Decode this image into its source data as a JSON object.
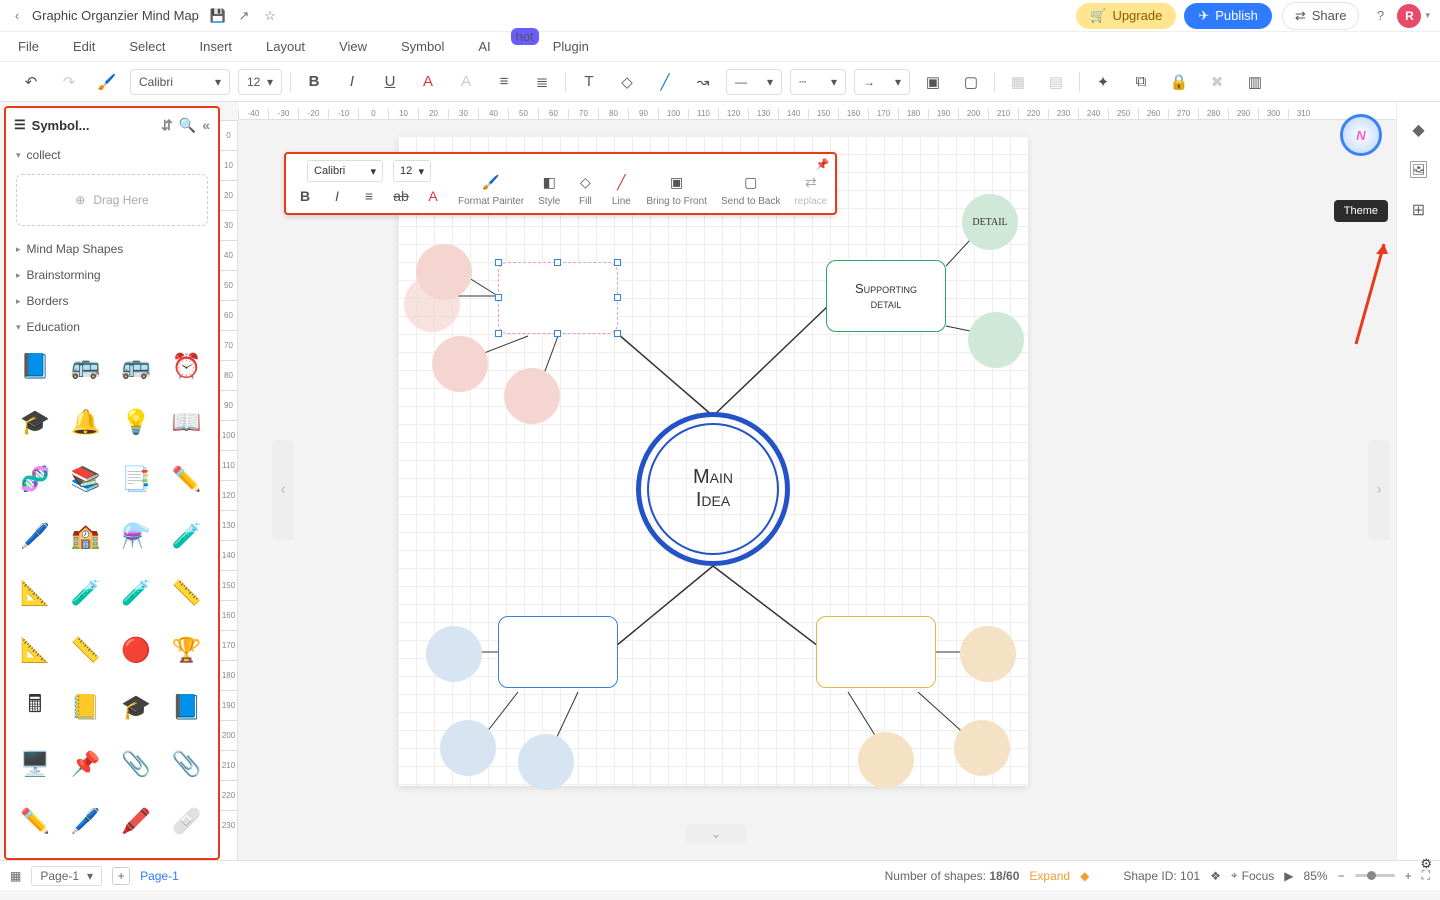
{
  "titlebar": {
    "doc_title": "Graphic Organzier Mind Map",
    "upgrade": "Upgrade",
    "publish": "Publish",
    "share": "Share",
    "avatar": "R"
  },
  "menubar": {
    "file": "File",
    "edit": "Edit",
    "select": "Select",
    "insert": "Insert",
    "layout": "Layout",
    "view": "View",
    "symbol": "Symbol",
    "ai": "AI",
    "ai_badge": "hot",
    "plugin": "Plugin"
  },
  "toolbar": {
    "font": "Calibri",
    "size": "12"
  },
  "left": {
    "title": "Symbol...",
    "sections": {
      "collect": "collect",
      "drag": "Drag Here",
      "mmshapes": "Mind Map Shapes",
      "brain": "Brainstorming",
      "borders": "Borders",
      "edu": "Education"
    },
    "icons": [
      "📘",
      "🚌",
      "🚌",
      "⏰",
      "🎓",
      "🔔",
      "💡",
      "📖",
      "🧬",
      "📚",
      "📑",
      "✏️",
      "🖊️",
      "🏫",
      "⚗️",
      "🧪",
      "📐",
      "🧪",
      "🧪",
      "📏",
      "📐",
      "📏",
      "🔴",
      "🏆",
      "🖩",
      "📒",
      "🎓",
      "📘",
      "🖥️",
      "📌",
      "📎",
      "📎",
      "✏️",
      "🖊️",
      "🖍️",
      "🩹"
    ]
  },
  "float": {
    "font": "Calibri",
    "size": "12",
    "fp": "Format Painter",
    "style": "Style",
    "fill": "Fill",
    "line": "Line",
    "btf": "Bring to Front",
    "stb": "Send to Back",
    "replace": "replace"
  },
  "mind": {
    "main1": "Main",
    "main2": "Idea",
    "sup1": "Supporting",
    "sup2": "detail",
    "detail": "DETAIL"
  },
  "right": {
    "tooltip": "Theme"
  },
  "ruler_h": [
    "-40",
    "-30",
    "-20",
    "-10",
    "0",
    "10",
    "20",
    "30",
    "40",
    "50",
    "60",
    "70",
    "80",
    "90",
    "100",
    "110",
    "120",
    "130",
    "140",
    "150",
    "160",
    "170",
    "180",
    "190",
    "200",
    "210",
    "220",
    "230",
    "240",
    "250",
    "260",
    "270",
    "280",
    "290",
    "300",
    "310"
  ],
  "ruler_v": [
    "0",
    "10",
    "20",
    "30",
    "40",
    "50",
    "60",
    "70",
    "80",
    "90",
    "100",
    "110",
    "120",
    "130",
    "140",
    "150",
    "160",
    "170",
    "180",
    "190",
    "200",
    "210",
    "220",
    "230"
  ],
  "status": {
    "page_sel": "Page-1",
    "tab": "Page-1",
    "shapes_lbl": "Number of shapes:",
    "shapes_val": "18/60",
    "expand": "Expand",
    "shape_id_lbl": "Shape ID:",
    "shape_id": "101",
    "focus": "Focus",
    "zoom": "85%"
  }
}
